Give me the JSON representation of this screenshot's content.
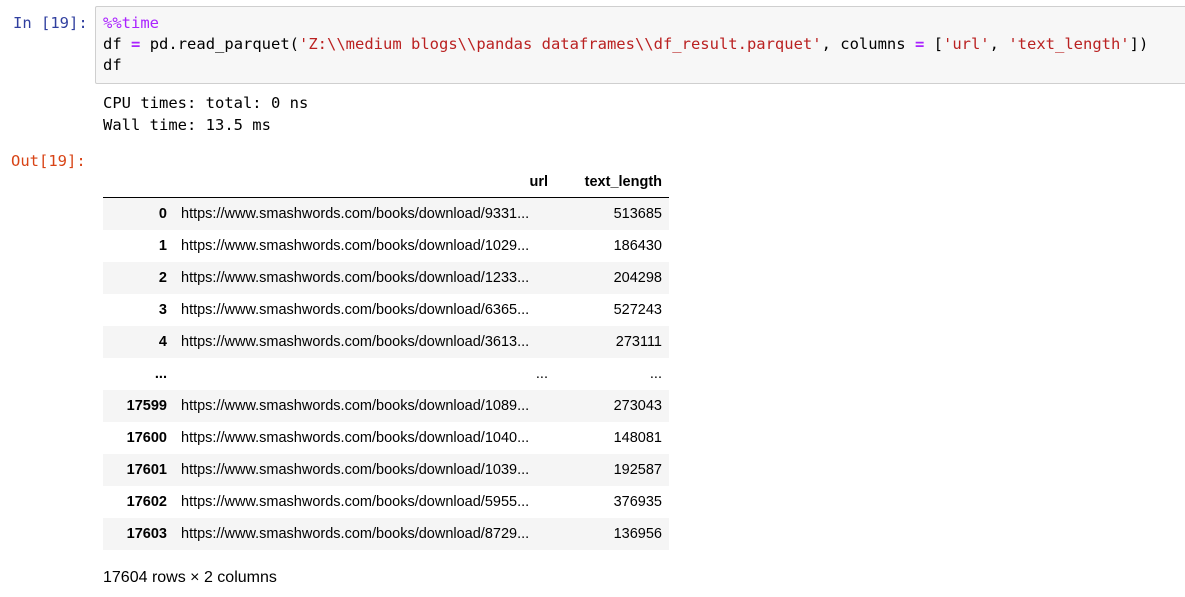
{
  "cell": {
    "in_prompt": "In [19]:",
    "out_prompt": "Out[19]:",
    "code": {
      "line1_magic": "%%time",
      "line2": {
        "var": "df",
        "assign": "=",
        "call": "pd.read_parquet(",
        "path_str": "'Z:\\\\medium blogs\\\\pandas dataframes\\\\df_result.parquet'",
        "mid": ", columns",
        "kw_eq": "=",
        "list_open": "[",
        "col1": "'url'",
        "sep": ", ",
        "col2": "'text_length'",
        "close": "])"
      },
      "line3": "df"
    },
    "stdout": {
      "line1": "CPU times: total: 0 ns",
      "line2": "Wall time: 13.5 ms"
    }
  },
  "dataframe": {
    "columns": [
      "url",
      "text_length"
    ],
    "rows": [
      {
        "index": "0",
        "url": "https://www.smashwords.com/books/download/9331...",
        "text_length": "513685"
      },
      {
        "index": "1",
        "url": "https://www.smashwords.com/books/download/1029...",
        "text_length": "186430"
      },
      {
        "index": "2",
        "url": "https://www.smashwords.com/books/download/1233...",
        "text_length": "204298"
      },
      {
        "index": "3",
        "url": "https://www.smashwords.com/books/download/6365...",
        "text_length": "527243"
      },
      {
        "index": "4",
        "url": "https://www.smashwords.com/books/download/3613...",
        "text_length": "273111"
      },
      {
        "index": "...",
        "url": "...",
        "text_length": "..."
      },
      {
        "index": "17599",
        "url": "https://www.smashwords.com/books/download/1089...",
        "text_length": "273043"
      },
      {
        "index": "17600",
        "url": "https://www.smashwords.com/books/download/1040...",
        "text_length": "148081"
      },
      {
        "index": "17601",
        "url": "https://www.smashwords.com/books/download/1039...",
        "text_length": "192587"
      },
      {
        "index": "17602",
        "url": "https://www.smashwords.com/books/download/5955...",
        "text_length": "376935"
      },
      {
        "index": "17603",
        "url": "https://www.smashwords.com/books/download/8729...",
        "text_length": "136956"
      }
    ],
    "shape_text": "17604 rows × 2 columns"
  }
}
